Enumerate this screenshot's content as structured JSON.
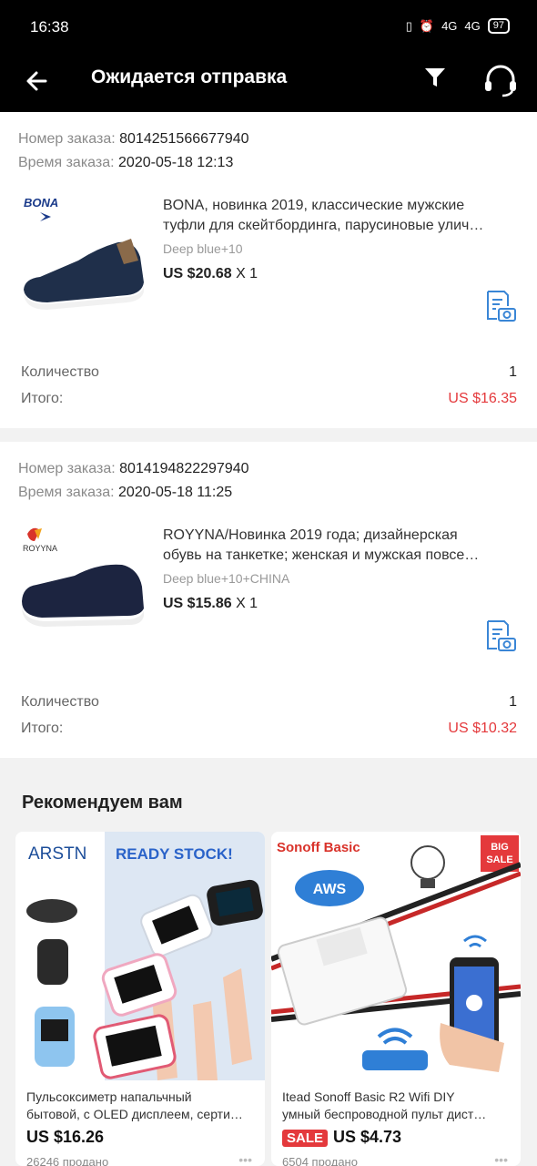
{
  "status_bar": {
    "time": "16:38",
    "network1": "4G",
    "network2": "4G",
    "battery": "97"
  },
  "app_bar": {
    "title": "Ожидается отправка"
  },
  "orders": [
    {
      "number_label": "Номер заказа:",
      "number": "8014251566677940",
      "time_label": "Время заказа:",
      "time": "2020-05-18 12:13",
      "brand": "BONA",
      "title_line1": "BONA, новинка 2019, классические мужские",
      "title_line2": "туфли для скейтбординга, парусиновые улич…",
      "variant": "Deep blue+10",
      "price": "US $20.68",
      "qty_mult": "X 1",
      "quantity_label": "Количество",
      "quantity": "1",
      "total_label": "Итого:",
      "total": "US $16.35"
    },
    {
      "number_label": "Номер заказа:",
      "number": "8014194822297940",
      "time_label": "Время заказа:",
      "time": "2020-05-18 11:25",
      "brand": "ROYYNA",
      "title_line1": "ROYYNA/Новинка 2019 года; дизайнерская",
      "title_line2": "обувь на танкетке; женская и мужская повсе…",
      "variant": "Deep blue+10+CHINA",
      "price": "US $15.86",
      "qty_mult": "X 1",
      "quantity_label": "Количество",
      "quantity": "1",
      "total_label": "Итого:",
      "total": "US $10.32"
    }
  ],
  "recommend": {
    "title": "Рекомендуем вам",
    "products": [
      {
        "img_brand": "ARSTN",
        "img_banner": "READY STOCK!",
        "name_line1": "Пульсоксиметр напальчный",
        "name_line2": "бытовой, с OLED дисплеем, серти…",
        "price": "US $16.26",
        "sold": "26246 продано"
      },
      {
        "img_brand": "Sonoff Basic",
        "img_badge_big": "BIG",
        "img_badge_sale": "SALE",
        "img_aws": "AWS",
        "name_line1": "Itead Sonoff Basic R2 Wifi DIY",
        "name_line2": "умный беспроводной пульт дист…",
        "sale_tag": "SALE",
        "price": "US $4.73",
        "sold": "6504 продано"
      }
    ]
  },
  "colors": {
    "accent_red": "#e4393c",
    "icon_blue": "#3a86d6"
  }
}
